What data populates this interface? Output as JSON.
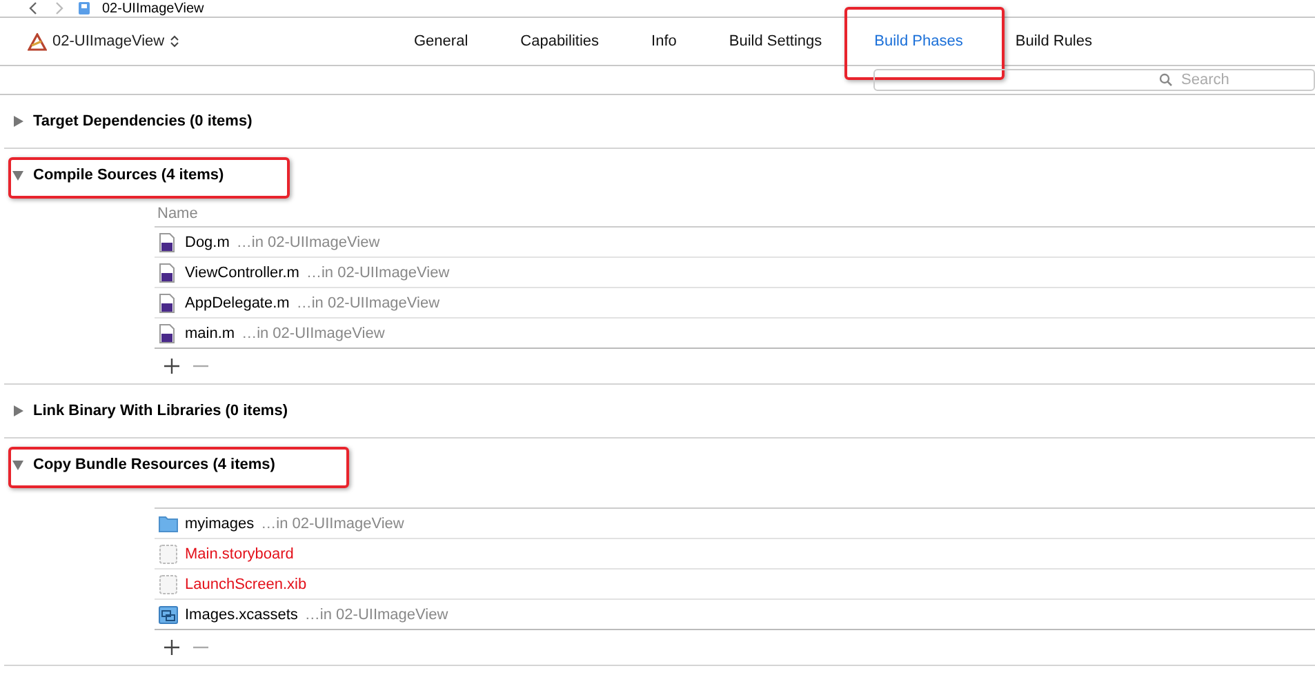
{
  "breadcrumb": {
    "title": "02-UIImageView"
  },
  "toolbar": {
    "target": "02-UIImageView",
    "tabs": [
      {
        "label": "General",
        "selected": false,
        "annotated": false
      },
      {
        "label": "Capabilities",
        "selected": false,
        "annotated": false
      },
      {
        "label": "Info",
        "selected": false,
        "annotated": false
      },
      {
        "label": "Build Settings",
        "selected": false,
        "annotated": false
      },
      {
        "label": "Build Phases",
        "selected": true,
        "annotated": true
      },
      {
        "label": "Build Rules",
        "selected": false,
        "annotated": false
      }
    ]
  },
  "search": {
    "placeholder": "Search"
  },
  "phases": [
    {
      "title": "Target Dependencies (0 items)",
      "expanded": false,
      "annotated": false
    },
    {
      "title": "Compile Sources (4 items)",
      "expanded": true,
      "annotated": true,
      "column": "Name",
      "files": [
        {
          "kind": "source",
          "name": "Dog.m",
          "location": "…in 02-UIImageView",
          "missing": false
        },
        {
          "kind": "source",
          "name": "ViewController.m",
          "location": "…in 02-UIImageView",
          "missing": false
        },
        {
          "kind": "source",
          "name": "AppDelegate.m",
          "location": "…in 02-UIImageView",
          "missing": false
        },
        {
          "kind": "source",
          "name": "main.m",
          "location": "…in 02-UIImageView",
          "missing": false
        }
      ]
    },
    {
      "title": "Link Binary With Libraries (0 items)",
      "expanded": false,
      "annotated": false
    },
    {
      "title": "Copy Bundle Resources (4 items)",
      "expanded": true,
      "annotated": true,
      "files": [
        {
          "kind": "folder",
          "name": "myimages",
          "location": "…in 02-UIImageView",
          "missing": false
        },
        {
          "kind": "blank",
          "name": "Main.storyboard",
          "missing": true
        },
        {
          "kind": "blank",
          "name": "LaunchScreen.xib",
          "missing": true
        },
        {
          "kind": "assets",
          "name": "Images.xcassets",
          "location": "…in 02-UIImageView",
          "missing": false
        }
      ]
    }
  ]
}
